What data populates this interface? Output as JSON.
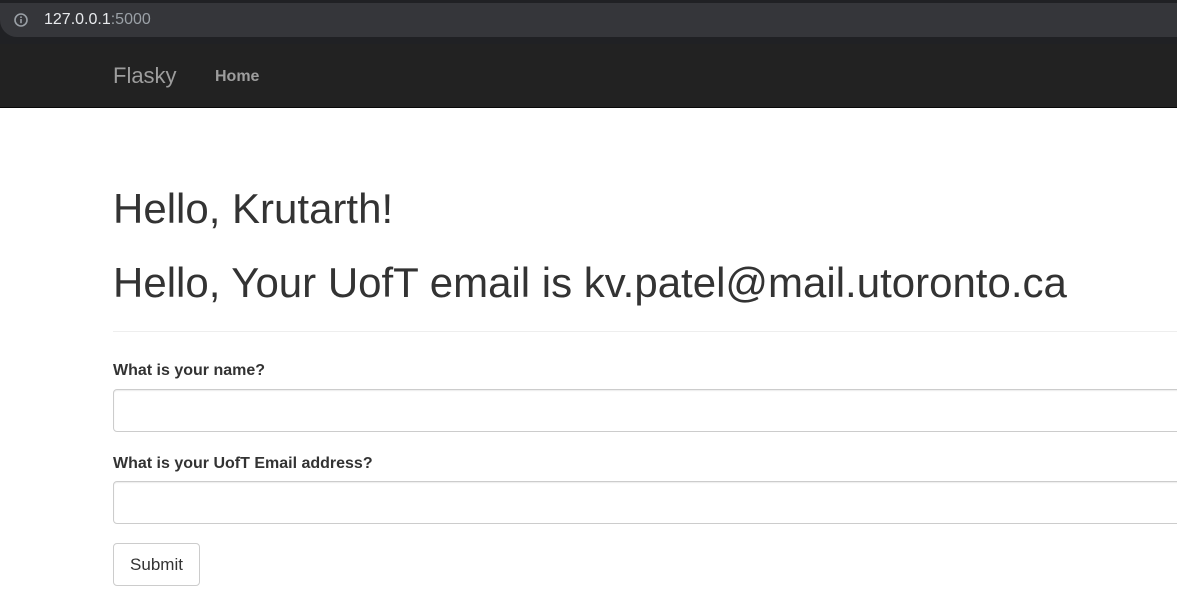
{
  "browser": {
    "url_host": "127.0.0.1",
    "url_port": ":5000",
    "icons": {
      "site_info": "info-icon"
    }
  },
  "navbar": {
    "brand": "Flasky",
    "items": [
      {
        "label": "Home"
      }
    ],
    "background": "#222222",
    "text_color": "#9d9d9d"
  },
  "header": {
    "greeting": "Hello, Krutarth!",
    "email_line": "Hello, Your UofT email is kv.patel@mail.utoronto.ca"
  },
  "form": {
    "name_label": "What is your name?",
    "name_value": "",
    "email_label": "What is your UofT Email address?",
    "email_value": "",
    "submit_label": "Submit"
  }
}
